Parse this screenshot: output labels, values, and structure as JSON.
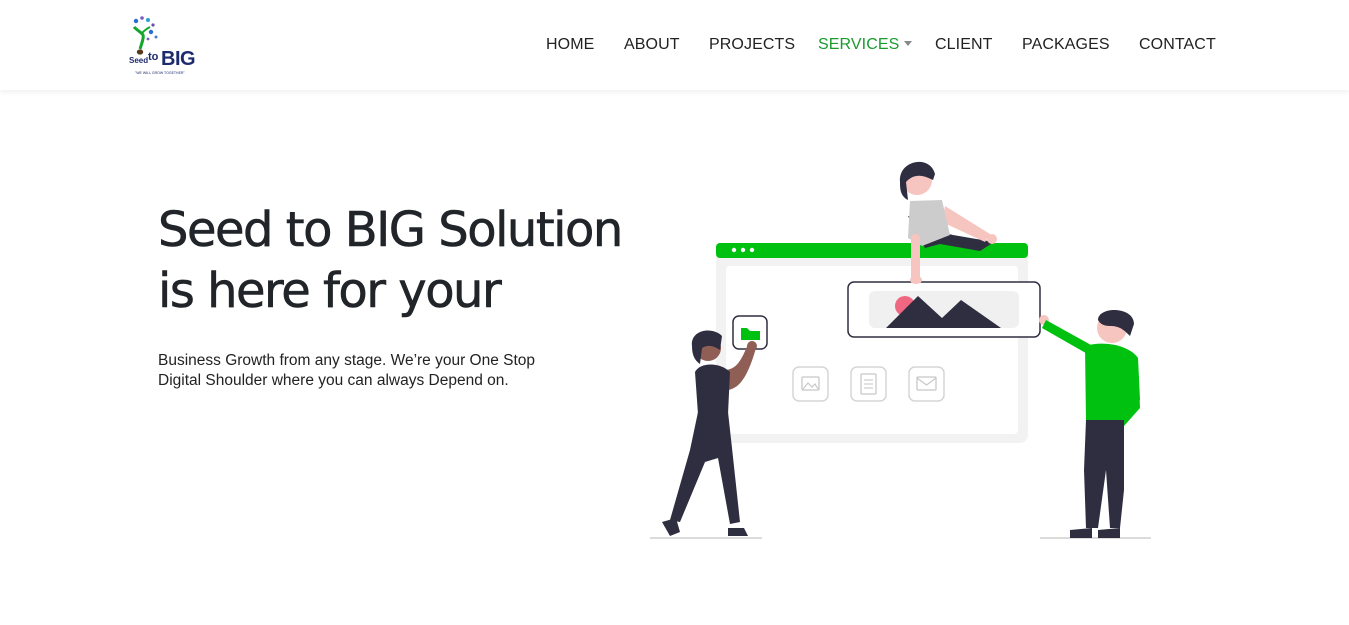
{
  "header": {
    "logo": {
      "wordmark_small": "Seed",
      "wordmark_to": "to",
      "wordmark_big": "BIG",
      "tagline": "\"WE WILL GROW TOGETHER\""
    },
    "nav": {
      "items": [
        {
          "label": "HOME"
        },
        {
          "label": "ABOUT"
        },
        {
          "label": "PROJECTS"
        },
        {
          "label": "SERVICES",
          "active": true,
          "has_dropdown": true
        },
        {
          "label": "CLIENT"
        },
        {
          "label": "PACKAGES"
        },
        {
          "label": "CONTACT"
        }
      ]
    }
  },
  "hero": {
    "title_line1": "Seed to BIG Solution",
    "title_line2": "is here for your",
    "subtitle_line1": "Business Growth from any stage. We’re your One Stop",
    "subtitle_line2": "Digital Shoulder where you can always Depend on."
  },
  "colors": {
    "accent_green": "#1a9b2e",
    "illustration_green": "#00c010",
    "dark_figure": "#2f2e41",
    "pink_accent": "#f06782"
  },
  "icons": [
    "folder-icon",
    "image-icon",
    "document-icon",
    "mail-icon",
    "picture-mountain-icon"
  ]
}
